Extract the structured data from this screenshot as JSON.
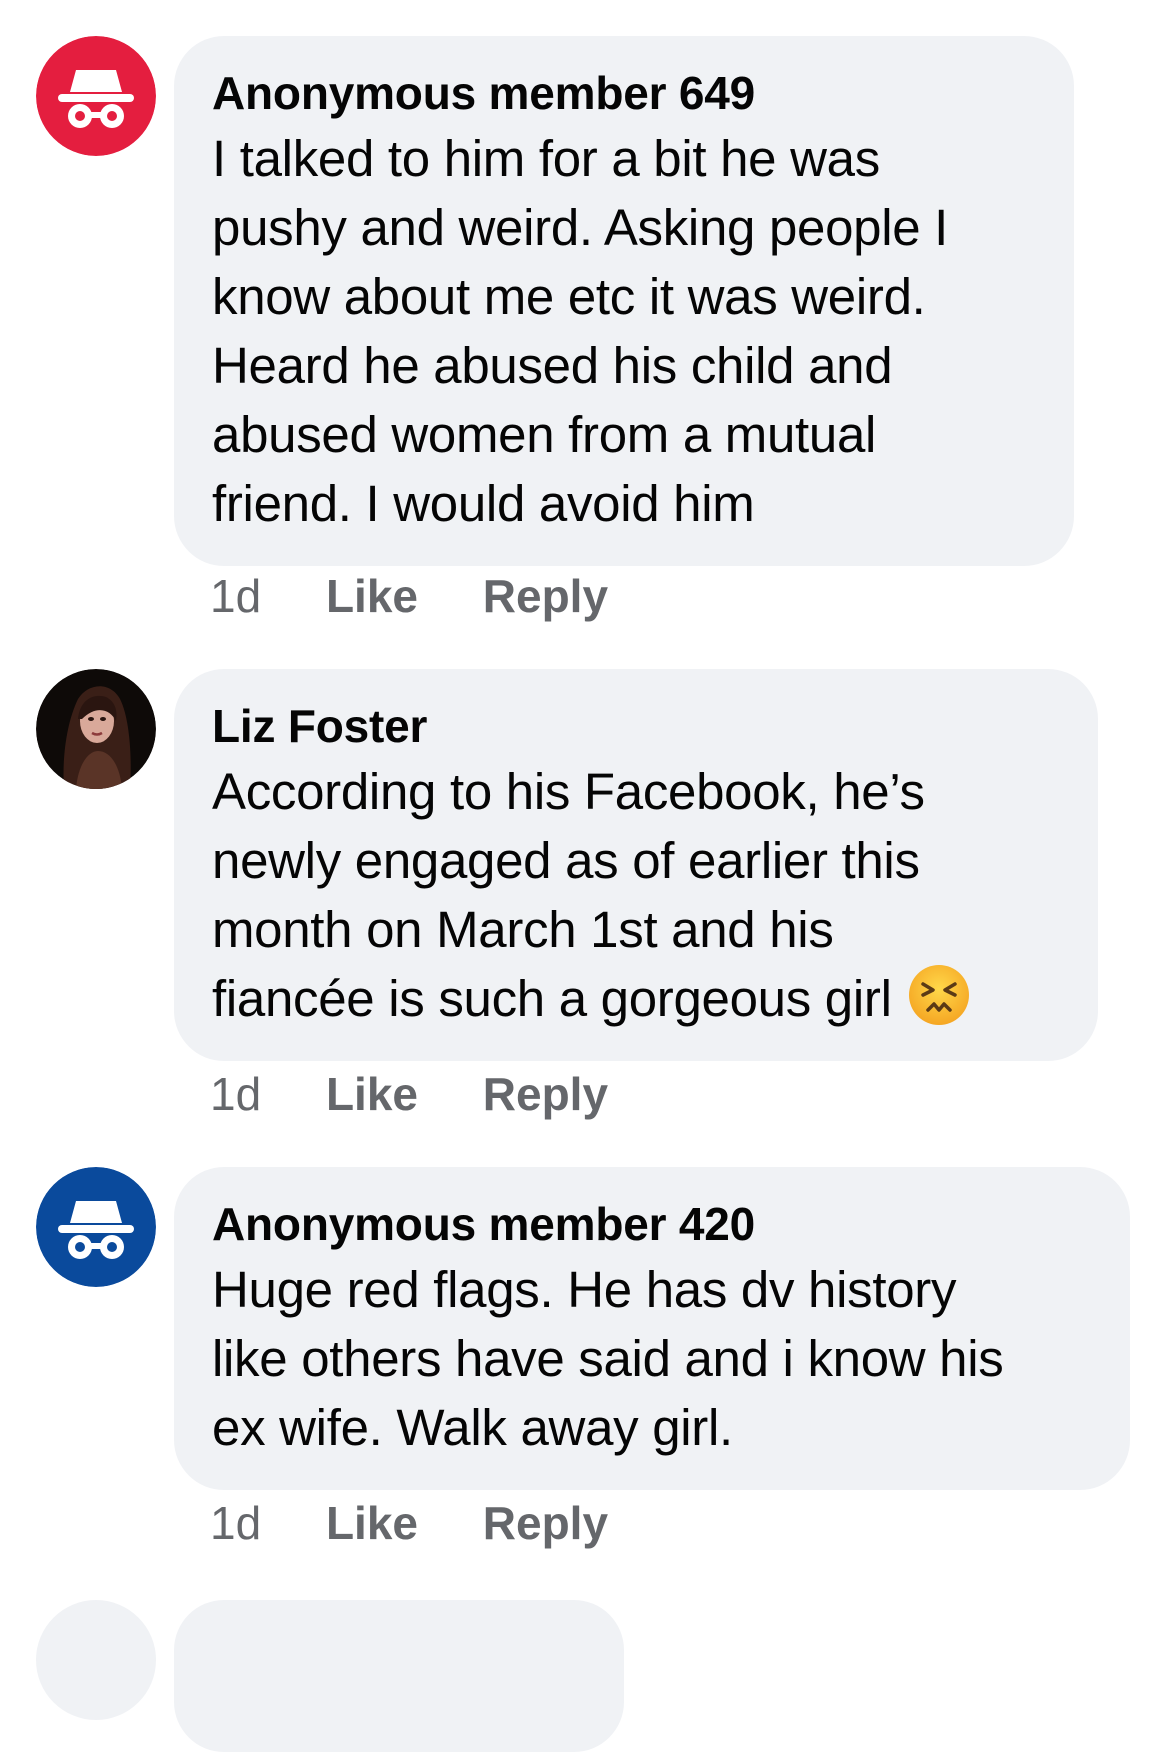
{
  "comments": [
    {
      "author": "Anonymous member 649",
      "avatar": "incognito-icon",
      "avatar_color": "#e41e3f",
      "lines": [
        "I talked to him for a bit he was",
        "pushy and weird. Asking people I",
        "know about me etc it was weird.",
        "Heard he abused his child and",
        "abused women from a mutual",
        "friend. I would avoid him"
      ],
      "time": "1d",
      "like": "Like",
      "reply": "Reply"
    },
    {
      "author": "Liz Foster",
      "avatar": "profile-photo",
      "lines": [
        "According to his Facebook, he’s",
        "newly engaged as of earlier this",
        "month on March 1st and his",
        "fiancée is such a gorgeous girl"
      ],
      "emoji": "persevering-face-emoji",
      "time": "1d",
      "like": "Like",
      "reply": "Reply"
    },
    {
      "author": "Anonymous member 420",
      "avatar": "incognito-icon",
      "avatar_color": "#0a4a9c",
      "lines": [
        "Huge red flags. He has dv history",
        "like others have said and i know his",
        "ex wife. Walk away girl."
      ],
      "time": "1d",
      "like": "Like",
      "reply": "Reply"
    }
  ],
  "colors": {
    "bubble": "#f0f2f5",
    "meta_text": "#65676b",
    "text": "#050505"
  }
}
